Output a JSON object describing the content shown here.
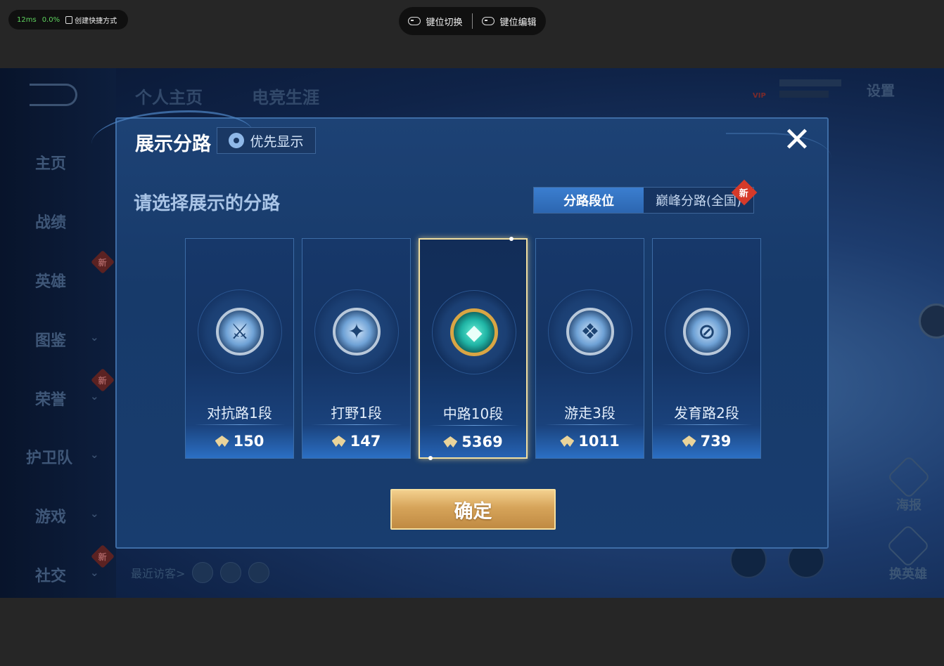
{
  "overlay": {
    "latency": "12ms",
    "loss": "0.0%",
    "shortcut_label": "创建快捷方式",
    "key_switch": "键位切换",
    "key_edit": "键位编辑"
  },
  "background": {
    "sidebar": [
      {
        "label": "主页",
        "chevron": false,
        "new": false
      },
      {
        "label": "战绩",
        "chevron": false,
        "new": false
      },
      {
        "label": "英雄",
        "chevron": false,
        "new": true
      },
      {
        "label": "图鉴",
        "chevron": true,
        "new": false
      },
      {
        "label": "荣誉",
        "chevron": true,
        "new": true
      },
      {
        "label": "护卫队",
        "chevron": true,
        "new": false
      },
      {
        "label": "游戏",
        "chevron": true,
        "new": false
      },
      {
        "label": "社交",
        "chevron": true,
        "new": true
      }
    ],
    "new_tag": "新",
    "tabs": [
      "个人主页",
      "电竞生涯"
    ],
    "vip_label": "VIP",
    "settings": "设置",
    "visitors": "最近访客>",
    "poster": "海报",
    "change_hero": "换英雄"
  },
  "modal": {
    "title": "展示分路",
    "priority_button": "优先显示",
    "close_symbol": "✕",
    "subtitle": "请选择展示的分路",
    "segments": [
      {
        "label": "分路段位",
        "active": true
      },
      {
        "label": "巅峰分路(全国)",
        "active": false
      }
    ],
    "segment_new_tag": "新",
    "lanes": [
      {
        "name": "对抗路1段",
        "points": "150",
        "selected": false
      },
      {
        "name": "打野1段",
        "points": "147",
        "selected": false
      },
      {
        "name": "中路10段",
        "points": "5369",
        "selected": true
      },
      {
        "name": "游走3段",
        "points": "1011",
        "selected": false
      },
      {
        "name": "发育路2段",
        "points": "739",
        "selected": false
      }
    ],
    "confirm": "确定"
  },
  "colors": {
    "accent_blue": "#2c66b0",
    "selected_border": "#f0dea0",
    "confirm_gold": "#d6a45a"
  }
}
